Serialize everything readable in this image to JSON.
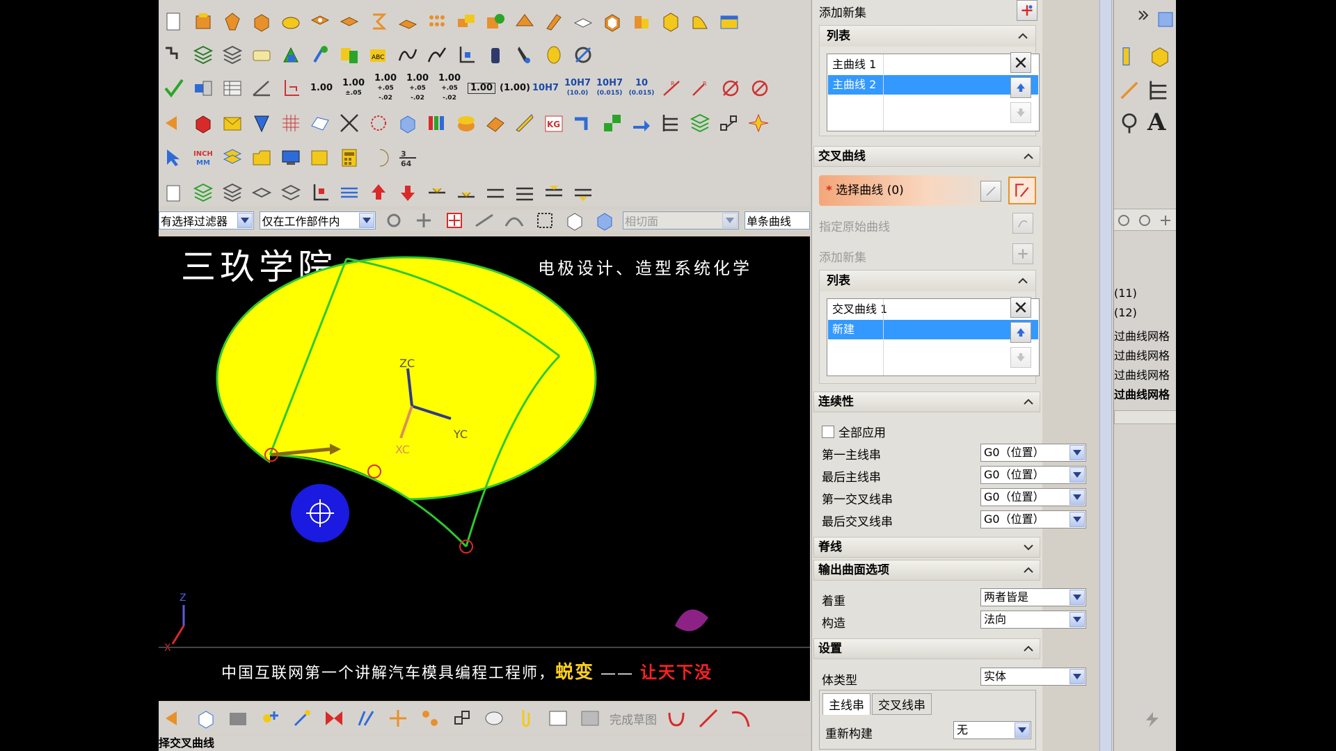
{
  "toolbar": {
    "numeric_buttons": [
      {
        "main": "1.00",
        "sub": ""
      },
      {
        "main": "1.00",
        "sub": "±.05"
      },
      {
        "main": "1.00",
        "sub": "+.05 -.02"
      },
      {
        "main": "1.00",
        "sub": "+.05 -.02"
      },
      {
        "main": "1.00",
        "sub": "+.05 -.02"
      },
      {
        "main": "1.00",
        "sub": ""
      },
      {
        "main": "(1.00)",
        "sub": ""
      },
      {
        "main": "10H7",
        "sub": ""
      },
      {
        "main": "10H7",
        "sub": "(10.0)"
      },
      {
        "main": "10H7",
        "sub": "(0.015)"
      },
      {
        "main": "10",
        "sub": "(0.015)"
      }
    ],
    "inch_label": "INCH",
    "mm_label": "MM",
    "accent_colors": {
      "orange": "#e8902a",
      "blue": "#2f6bd8",
      "green": "#2aa52a",
      "red": "#d92a2a",
      "yellow": "#f2c81c"
    }
  },
  "filter_bar": {
    "type_filter": "有选择过滤器",
    "scope_filter": "仅在工作部件内",
    "snap_dropdown": "相切面",
    "curve_rule": "单条曲线"
  },
  "viewport": {
    "banner_title": "三玖学院",
    "banner_sub": "电极设计、造型系统化学",
    "ticker_prefix": "中国互联网第一个讲解汽车模具编程工程师，",
    "ticker_highlight": "蜕变",
    "ticker_dash": "——",
    "ticker_red": "让天下没",
    "axis_labels": {
      "zc": "ZC",
      "xc": "XC",
      "yc": "YC",
      "z": "Z",
      "x": "X"
    },
    "colors": {
      "surface": "#ffff00",
      "edge": "#2ec82e",
      "background": "#000000"
    }
  },
  "bottom_toolbar": {
    "finish_sketch": "完成草图"
  },
  "status_bar": {
    "text": "择交叉曲线"
  },
  "panel": {
    "add_set_top": "添加新集",
    "primary_list": {
      "header": "列表",
      "items": [
        {
          "label": "主曲线 1",
          "selected": false
        },
        {
          "label": "主曲线 2",
          "selected": true
        }
      ]
    },
    "cross_section": {
      "header": "交叉曲线",
      "select_curve": "选择曲线 (0)",
      "specify_original": "指定原始曲线",
      "add_set": "添加新集",
      "list_header": "列表",
      "items": [
        {
          "label": "交叉曲线 1",
          "selected": false
        },
        {
          "label": "新建",
          "selected": true
        }
      ]
    },
    "continuity": {
      "header": "连续性",
      "apply_all": "全部应用",
      "rows": [
        {
          "label": "第一主线串",
          "value": "G0（位置）"
        },
        {
          "label": "最后主线串",
          "value": "G0（位置）"
        },
        {
          "label": "第一交叉线串",
          "value": "G0（位置）"
        },
        {
          "label": "最后交叉线串",
          "value": "G0（位置）"
        }
      ]
    },
    "spine": {
      "header": "脊线"
    },
    "output_options": {
      "header": "输出曲面选项",
      "emphasis_label": "着重",
      "emphasis_value": "两者皆是",
      "construction_label": "构造",
      "construction_value": "法向"
    },
    "settings": {
      "header": "设置",
      "body_type_label": "体类型",
      "body_type_value": "实体",
      "tab_primary": "主线串",
      "tab_cross": "交叉线串",
      "rebuild_label": "重新构建",
      "rebuild_value": "无"
    }
  },
  "right_strip": {
    "items": [
      "(11)",
      "(12)",
      "过曲线网格",
      "过曲线网格",
      "过曲线网格",
      "过曲线网格"
    ]
  }
}
